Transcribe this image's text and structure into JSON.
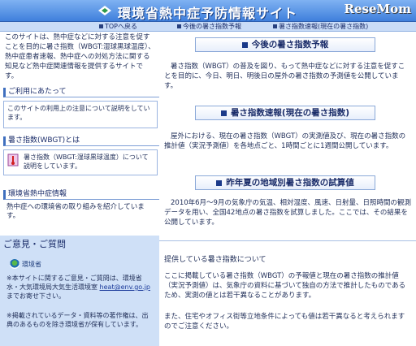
{
  "header": {
    "title": "環境省熱中症予防情報サイト",
    "watermark": "ReseMom",
    "brand_color": "#3f7fdc"
  },
  "nav": {
    "items": [
      "TOPへ戻る",
      "今後の暑さ指数予報",
      "暑さ指数速報(現在の暑さ指数)"
    ]
  },
  "sidebar": {
    "intro": "このサイトは、熱中症などに対する注意を促すことを目的に暑さ指数（WBGT:湿球黒球温度）、熱中症患者速報、熱中症への対処方法に関する知見など熱中症関連情報を提供するサイトです。",
    "usage": {
      "title": "ご利用にあたって",
      "text": "このサイトの利用上の注意について説明をしています。"
    },
    "wbgt": {
      "title": "暑さ指数(WBGT)とは",
      "text": "暑さ指数（WBGT:湿球黒球温度）について説明をしています。"
    },
    "ministry": {
      "title": "環境省熱中症情報",
      "text": "熱中症への環境省の取り組みを紹介しています。"
    }
  },
  "feedback": {
    "title": "ご意見・ご質問",
    "logo_label": "環境省",
    "text1": "※本サイトに関するご意見・ご質問は、環境省水・大気環境局大気生活環境室",
    "email": "heat@env.go.jp",
    "text1b": "までお寄せ下さい。",
    "text2": "※掲載されているデータ・資料等の著作権は、出典のあるものを除き環境省が保有しています。"
  },
  "main": {
    "forecast_button": "今後の暑さ指数予報",
    "forecast_text": "暑さ指数（WBGT）の普及を図り、もって熱中症などに対する注意を促すことを目的に、今日、明日、明後日の屋外の暑さ指数の予測値を公開しています。",
    "current_button": "暑さ指数速報(現在の暑さ指数)",
    "current_text": "屋外における、現在の暑さ指数（WBGT）の実測値及び、現在の暑さ指数の推計値（実況予測値）を各地点ごと、1時間ごとに1週間公開しています。",
    "trial_button": "昨年夏の地域別暑さ指数の試算値",
    "trial_text": "2010年6月～9月の気象庁の気温、相対湿度、風速、日射量、日照時間の観測データを用い、全国42地点の暑さ指数を試算しました。ここでは、その結果を公開しています。",
    "section_title": "提供している暑さ指数について",
    "section_text1": "ここに掲載している暑さ指数（WBGT）の予報値と現在の暑さ指数の推計値（実況予測値）は、気象庁の資料に基づいて独自の方法で推計したものであるため、実測の値とは若干異なることがあります。",
    "section_text2": "また、住宅やオフィス街等立地条件によっても値は若干異なると考えられますのでご注意ください。"
  }
}
